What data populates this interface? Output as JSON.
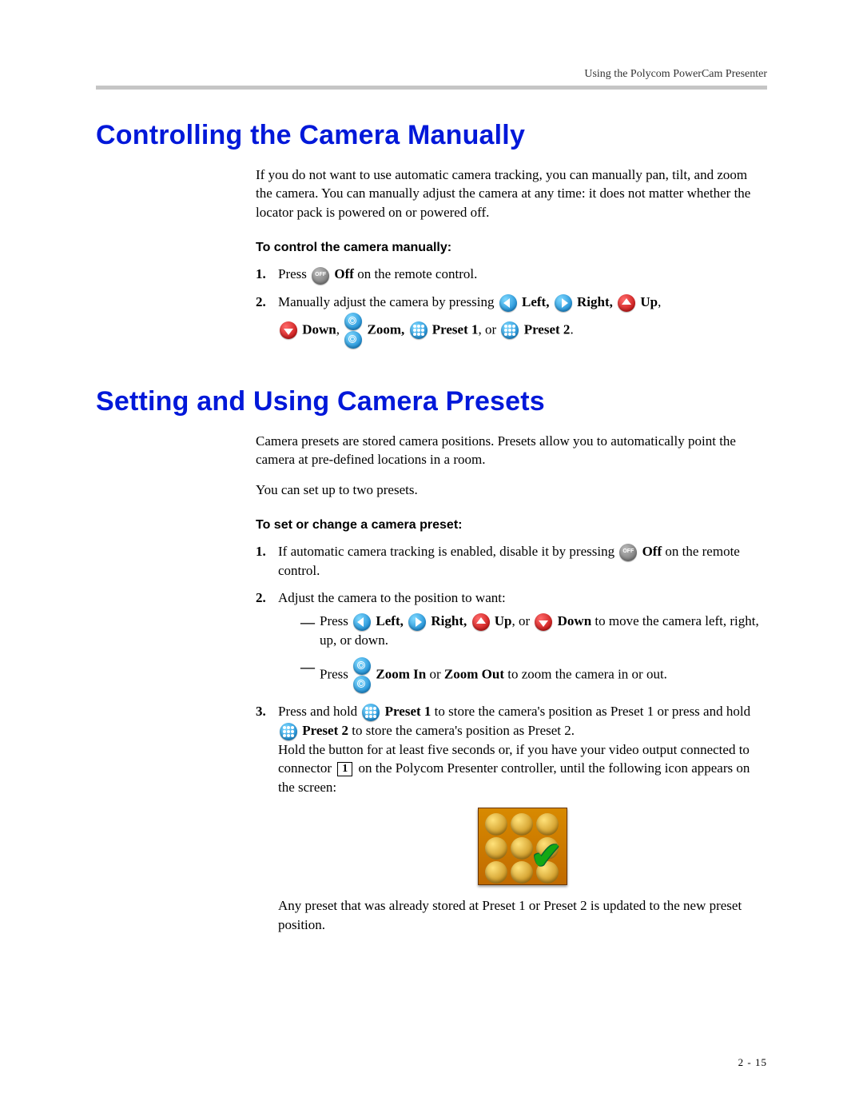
{
  "header": {
    "running": "Using the Polycom PowerCam Presenter"
  },
  "section1": {
    "title": "Controlling the Camera Manually",
    "intro": "If you do not want to use automatic camera tracking, you can manually pan, tilt, and zoom the camera. You can manually adjust the camera at any time: it does not matter whether the locator pack is powered on or powered off.",
    "subhead": "To control the camera manually:",
    "step1_a": "Press ",
    "step1_b": " Off",
    "step1_c": " on the remote control.",
    "step2_a": "Manually adjust the camera by pressing ",
    "lbl_left": " Left, ",
    "lbl_right": " Right, ",
    "lbl_up": " Up",
    "lbl_down": " Down",
    "lbl_zoom": "  Zoom, ",
    "lbl_p1": " Preset 1",
    "lbl_or": ", or ",
    "lbl_p2": " Preset 2",
    "period": "."
  },
  "section2": {
    "title": "Setting and Using Camera Presets",
    "intro1": "Camera presets are stored camera positions. Presets allow you to automatically point the camera at pre-defined locations in a room.",
    "intro2": "You can set up to two presets.",
    "subhead": "To set or change a camera preset:",
    "s1a": "If automatic camera tracking is enabled, disable it by pressing ",
    "s1b": " Off",
    "s1c": " on the remote control.",
    "s2": "Adjust the camera to the position to want:",
    "s2a_a": "Press ",
    "s2a_left": " Left, ",
    "s2a_right": " Right, ",
    "s2a_up": " Up",
    "s2a_or": ", or ",
    "s2a_down": " Down",
    "s2a_tail": " to move the camera left, right, up, or down.",
    "s2b_a": "Press ",
    "s2b_mid": "  Zoom In",
    "s2b_or": " or ",
    "s2b_out": "Zoom Out",
    "s2b_tail": " to zoom the camera in or out.",
    "s3a": "Press and hold ",
    "s3_p1": " Preset 1",
    "s3_mid": " to store the camera's position as Preset 1 or press and hold ",
    "s3_p2": " Preset 2",
    "s3_tail": " to store the camera's position as Preset 2.",
    "hold_a": "Hold the button for at least five seconds or, if you have your video output connected to connector ",
    "hold_num": "1",
    "hold_b": " on the Polycom Presenter controller, until the following icon appears on the screen:",
    "after": "Any preset that was already stored at Preset 1 or Preset 2 is updated to the new preset position."
  },
  "footer": {
    "pagenum": "2 - 15"
  },
  "comma": ", "
}
